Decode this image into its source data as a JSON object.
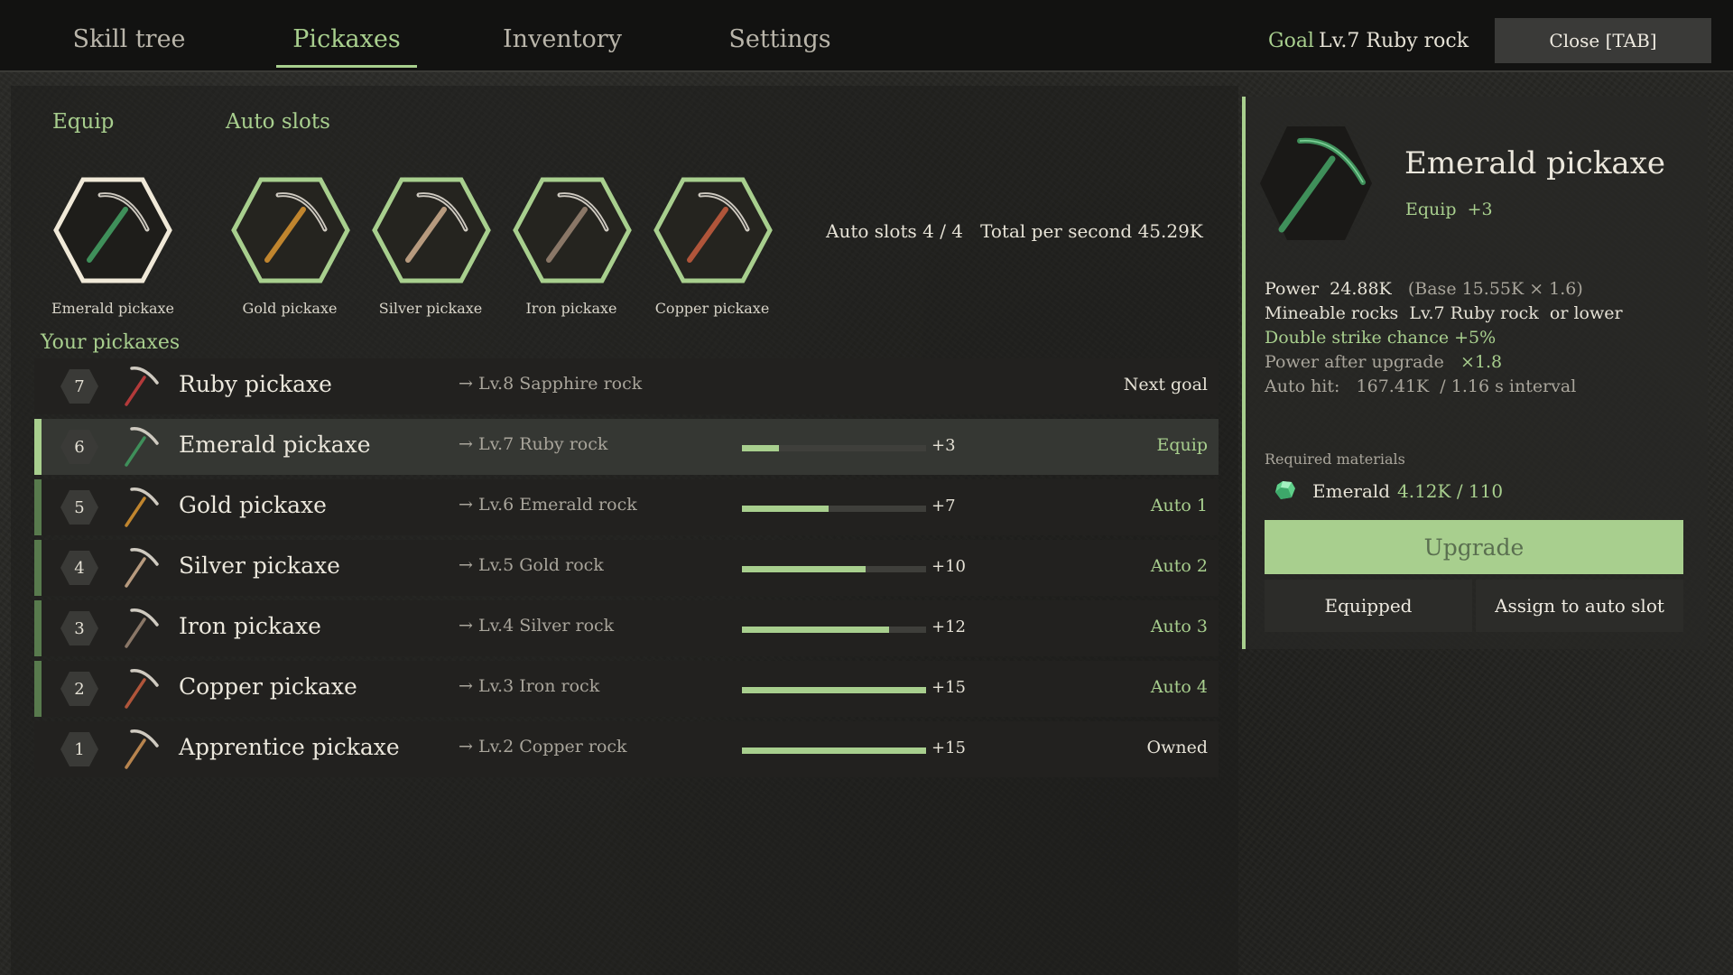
{
  "tabs": [
    {
      "label": "Skill tree",
      "active": false
    },
    {
      "label": "Pickaxes",
      "active": true
    },
    {
      "label": "Inventory",
      "active": false
    },
    {
      "label": "Settings",
      "active": false
    }
  ],
  "goal": {
    "label": "Goal",
    "value": "Lv.7 Ruby rock"
  },
  "close_label": "Close  [TAB]",
  "equip": {
    "label": "Equip",
    "slot": {
      "name": "Emerald pickaxe",
      "color": "#3f8f5a"
    }
  },
  "auto_slots": {
    "label": "Auto slots",
    "slots": [
      {
        "name": "Gold pickaxe",
        "color": "#c0852e"
      },
      {
        "name": "Silver pickaxe",
        "color": "#b79a7e"
      },
      {
        "name": "Iron pickaxe",
        "color": "#8a7767"
      },
      {
        "name": "Copper pickaxe",
        "color": "#b0553a"
      }
    ],
    "summary": "Auto slots 4 / 4   Total per second 45.29K"
  },
  "list": {
    "title": "Your pickaxes",
    "rows": [
      {
        "level": "7",
        "name": "Ruby pickaxe",
        "target": "→ Lv.8 Sapphire rock",
        "progress": null,
        "bonus": "",
        "status": "Next goal",
        "status_style": "plain",
        "color": "#b33a3a",
        "selected": false,
        "accent": false
      },
      {
        "level": "6",
        "name": "Emerald pickaxe",
        "target": "→ Lv.7 Ruby rock",
        "progress": 0.2,
        "bonus": "+3",
        "status": "Equip",
        "status_style": "green",
        "color": "#3f8f5a",
        "selected": true,
        "accent": true
      },
      {
        "level": "5",
        "name": "Gold pickaxe",
        "target": "→ Lv.6 Emerald rock",
        "progress": 0.47,
        "bonus": "+7",
        "status": "Auto 1",
        "status_style": "green",
        "color": "#c0852e",
        "selected": false,
        "accent": true
      },
      {
        "level": "4",
        "name": "Silver pickaxe",
        "target": "→ Lv.5 Gold rock",
        "progress": 0.67,
        "bonus": "+10",
        "status": "Auto 2",
        "status_style": "green",
        "color": "#b79a7e",
        "selected": false,
        "accent": true
      },
      {
        "level": "3",
        "name": "Iron pickaxe",
        "target": "→ Lv.4 Silver rock",
        "progress": 0.8,
        "bonus": "+12",
        "status": "Auto 3",
        "status_style": "green",
        "color": "#8a7767",
        "selected": false,
        "accent": true
      },
      {
        "level": "2",
        "name": "Copper pickaxe",
        "target": "→ Lv.3 Iron rock",
        "progress": 1.0,
        "bonus": "+15",
        "status": "Auto 4",
        "status_style": "green",
        "color": "#b0553a",
        "selected": false,
        "accent": true
      },
      {
        "level": "1",
        "name": "Apprentice pickaxe",
        "target": "→ Lv.2 Copper rock",
        "progress": 1.0,
        "bonus": "+15",
        "status": "Owned",
        "status_style": "plain",
        "color": "#b8844e",
        "selected": false,
        "accent": false
      }
    ]
  },
  "detail": {
    "name": "Emerald pickaxe",
    "equip_label": "Equip",
    "equip_bonus": "+3",
    "color": "#3f8f5a",
    "power_label": "Power",
    "power_value": "24.88K",
    "power_formula": "(Base 15.55K × 1.6)",
    "mineable_label": "Mineable rocks",
    "mineable_value": "Lv.7 Ruby rock",
    "mineable_suffix": "or lower",
    "double_strike": "Double strike chance +5%",
    "after_upgrade_label": "Power after upgrade",
    "after_upgrade_value": "×1.8",
    "auto_hit_label": "Auto hit:",
    "auto_hit_value": "167.41K  / 1.16 s interval",
    "required_label": "Required materials",
    "material_icon": "emerald-gem-icon",
    "material_name": "Emerald",
    "material_count": "4.12K / 110",
    "upgrade_label": "Upgrade",
    "equipped_label": "Equipped",
    "assign_label": "Assign to auto slot"
  }
}
